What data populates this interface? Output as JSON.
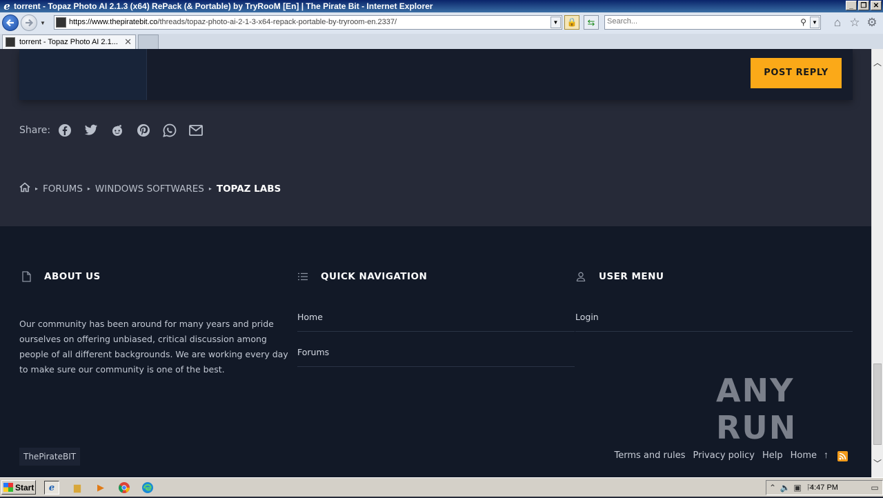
{
  "window": {
    "title": "torrent - Topaz Photo AI 2.1.3 (x64) RePack (& Portable) by TryRooM [En] | The Pirate Bit - Internet Explorer"
  },
  "navbar": {
    "url_host": "https://www.thepiratebit.co",
    "url_path": "/threads/topaz-photo-ai-2-1-3-x64-repack-portable-by-tryroom-en.2337/",
    "search_placeholder": "Search..."
  },
  "tabs": [
    {
      "label": "torrent - Topaz Photo AI 2.1...",
      "active": true
    }
  ],
  "page": {
    "post_reply_label": "POST REPLY",
    "share_label": "Share:",
    "share_icons": [
      "facebook-icon",
      "twitter-icon",
      "reddit-icon",
      "pinterest-icon",
      "whatsapp-icon",
      "email-icon"
    ],
    "breadcrumb": [
      "FORUMS",
      "WINDOWS SOFTWARES",
      "TOPAZ LABS"
    ],
    "accent_color": "#fba918"
  },
  "footer": {
    "about": {
      "title": "ABOUT US",
      "text": "Our community has been around for many years and pride ourselves on offering unbiased, critical discussion among people of all different backgrounds. We are working every day to make sure our community is one of the best."
    },
    "quick_nav": {
      "title": "QUICK NAVIGATION",
      "links": [
        "Home",
        "Forums"
      ]
    },
    "user_menu": {
      "title": "USER MENU",
      "links": [
        "Login"
      ]
    },
    "copyright": "ThePirateBIT",
    "bottom_links": [
      "Terms and rules",
      "Privacy policy",
      "Help",
      "Home"
    ]
  },
  "watermark": "ANY RUN",
  "taskbar": {
    "start_label": "Start",
    "clock": "4:47 PM"
  }
}
